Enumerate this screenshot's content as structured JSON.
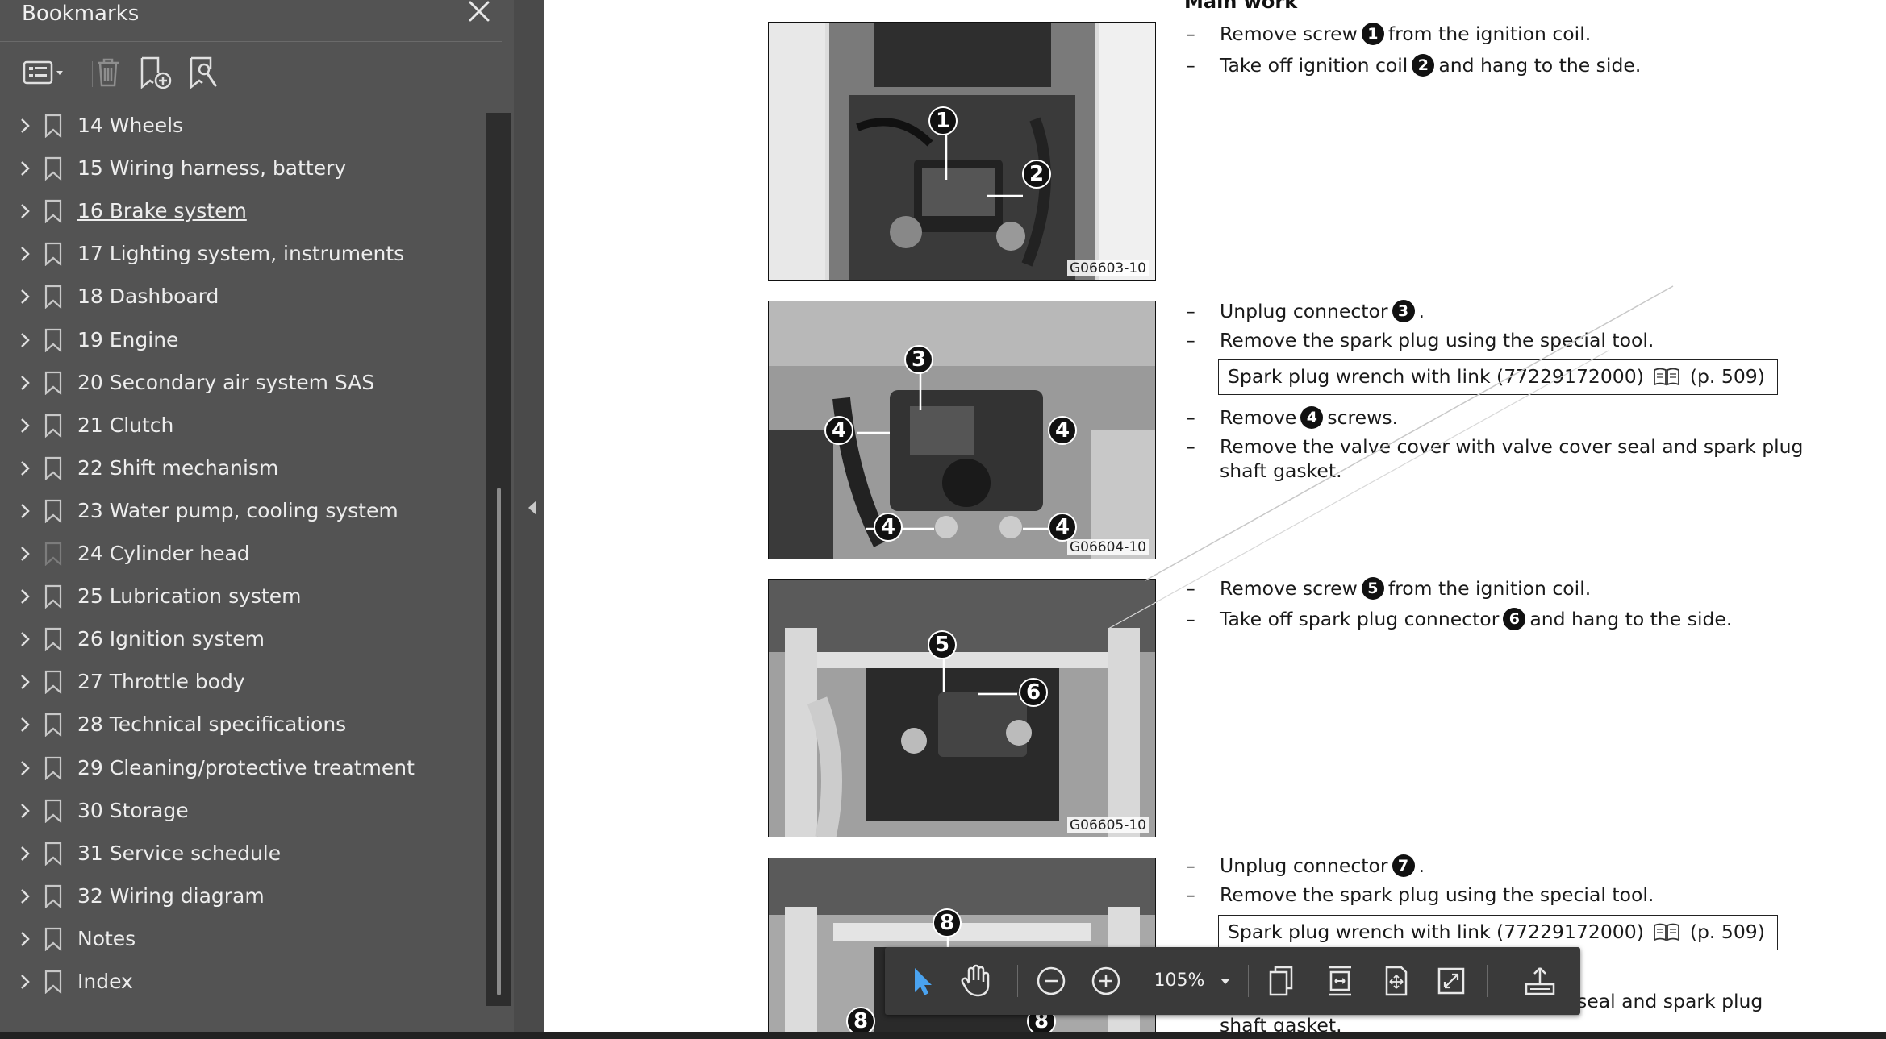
{
  "sidebar": {
    "title": "Bookmarks",
    "items": [
      {
        "label": "14 Wheels"
      },
      {
        "label": "15 Wiring harness, battery"
      },
      {
        "label": "16 Brake system"
      },
      {
        "label": "17 Lighting system, instruments"
      },
      {
        "label": "18 Dashboard"
      },
      {
        "label": "19 Engine"
      },
      {
        "label": "20 Secondary air system SAS"
      },
      {
        "label": "21 Clutch"
      },
      {
        "label": "22 Shift mechanism"
      },
      {
        "label": "23 Water pump, cooling system"
      },
      {
        "label": "24 Cylinder head"
      },
      {
        "label": "25 Lubrication system"
      },
      {
        "label": "26 Ignition system"
      },
      {
        "label": "27 Throttle body"
      },
      {
        "label": "28 Technical specifications"
      },
      {
        "label": "29 Cleaning/protective treatment"
      },
      {
        "label": "30 Storage"
      },
      {
        "label": "31 Service schedule"
      },
      {
        "label": "32 Wiring diagram"
      },
      {
        "label": "Notes"
      },
      {
        "label": "Index"
      }
    ]
  },
  "document": {
    "section_heading": "Main work",
    "figures": [
      {
        "code": "G06603-10",
        "callouts": [
          "1",
          "2"
        ]
      },
      {
        "code": "G06604-10",
        "callouts": [
          "3",
          "4",
          "4",
          "4",
          "4"
        ]
      },
      {
        "code": "G06605-10",
        "callouts": [
          "5",
          "6"
        ]
      },
      {
        "code": "",
        "callouts": [
          "8",
          "8",
          "8"
        ]
      }
    ],
    "steps": {
      "s1": {
        "pre": "Remove screw",
        "num": "1",
        "post": "from the ignition coil."
      },
      "s2": {
        "pre": "Take off ignition coil",
        "num": "2",
        "post": "and hang to the side."
      },
      "s3": {
        "pre": "Unplug connector",
        "num": "3",
        "post": "."
      },
      "s4": {
        "text": "Remove the spark plug using the special tool."
      },
      "tool1": {
        "name": "Spark plug wrench with link (77229172000)",
        "ref": "(p. 509)"
      },
      "s5": {
        "pre": "Remove",
        "num": "4",
        "post": "screws."
      },
      "s6a": {
        "text": "Remove the valve cover with valve cover seal and spark plug"
      },
      "s6b": {
        "text": "shaft gasket."
      },
      "s7": {
        "pre": "Remove screw",
        "num": "5",
        "post": "from the ignition coil."
      },
      "s8": {
        "pre": "Take off spark plug connector",
        "num": "6",
        "post": "and hang to the side."
      },
      "s9": {
        "pre": "Unplug connector",
        "num": "7",
        "post": "."
      },
      "s10": {
        "text": "Remove the spark plug using the special tool."
      },
      "tool2": {
        "name": "Spark plug wrench with link (77229172000)",
        "ref": "(p. 509)"
      },
      "s11a": {
        "text": "seal and spark plug"
      },
      "s11b": {
        "text": "shaft gasket."
      }
    }
  },
  "toolbar": {
    "zoom": "105%"
  },
  "colors": {
    "sidebar_bg": "#535353",
    "toolbar_bg": "#3a3a3a",
    "select_accent": "#4aa3f0"
  }
}
